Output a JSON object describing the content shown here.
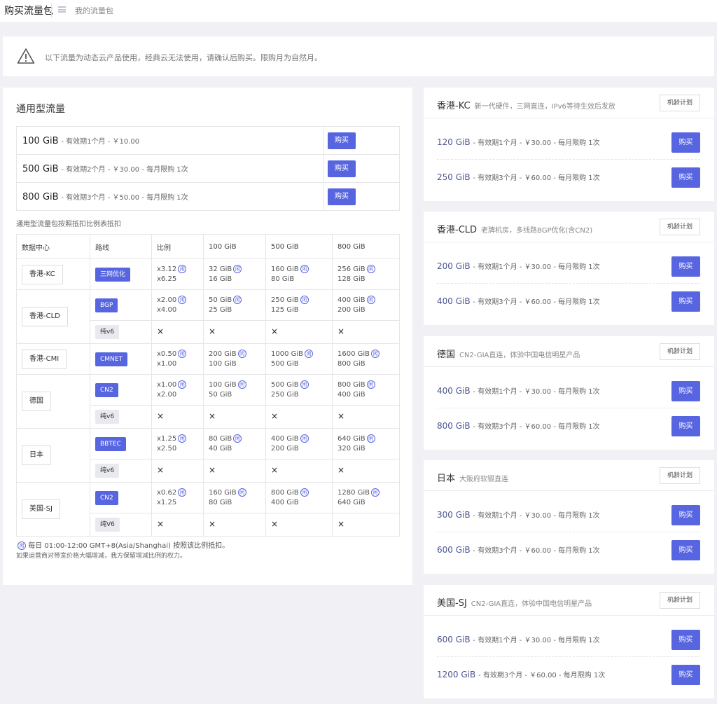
{
  "header": {
    "title": "购买流量包",
    "breadcrumb": "我的流量包"
  },
  "notice": {
    "text": "以下流量为动态云产品使用，经典云无法使用，请确认后购买。限购月为自然月。"
  },
  "general": {
    "title": "通用型流量",
    "buy_label": "购买",
    "packages": [
      {
        "size": "100 GiB",
        "meta": "- 有效期1个月 - ￥10.00"
      },
      {
        "size": "500 GiB",
        "meta": "- 有效期2个月 - ￥30.00 - 每月限购 1次"
      },
      {
        "size": "800 GiB",
        "meta": "- 有效期3个月 - ￥50.00 - 每月限购 1次"
      }
    ],
    "ratio_note": "通用型流量包按照抵扣比例表抵扣",
    "table_headers": [
      "数据中心",
      "路线",
      "比例",
      "100 GiB",
      "500 GiB",
      "800 GiB"
    ],
    "idle_mark": "闲",
    "x_mark": "×",
    "rows": [
      {
        "dc": "香港-KC",
        "route": "三网优化",
        "ratio": [
          "x3.12",
          "x6.25"
        ],
        "g100": [
          "32 GiB",
          "16 GiB"
        ],
        "g500": [
          "160 GiB",
          "80 GiB"
        ],
        "g800": [
          "256 GiB",
          "128 GiB"
        ]
      },
      {
        "dc": "香港-CLD",
        "route": "BGP",
        "ratio": [
          "x2.00",
          "x4.00"
        ],
        "g100": [
          "50 GiB",
          "25 GiB"
        ],
        "g500": [
          "250 GiB",
          "125 GiB"
        ],
        "g800": [
          "400 GiB",
          "200 GiB"
        ],
        "sub": "纯v6"
      },
      {
        "dc": "香港-CMI",
        "route": "CMNET",
        "ratio": [
          "x0.50",
          "x1.00"
        ],
        "g100": [
          "200 GiB",
          "100 GiB"
        ],
        "g500": [
          "1000 GiB",
          "500 GiB"
        ],
        "g800": [
          "1600 GiB",
          "800 GiB"
        ]
      },
      {
        "dc": "德国",
        "route": "CN2",
        "ratio": [
          "x1.00",
          "x2.00"
        ],
        "g100": [
          "100 GiB",
          "50 GiB"
        ],
        "g500": [
          "500 GiB",
          "250 GiB"
        ],
        "g800": [
          "800 GiB",
          "400 GiB"
        ],
        "sub": "纯v6"
      },
      {
        "dc": "日本",
        "route": "BBTEC",
        "ratio": [
          "x1.25",
          "x2.50"
        ],
        "g100": [
          "80 GiB",
          "40 GiB"
        ],
        "g500": [
          "400 GiB",
          "200 GiB"
        ],
        "g800": [
          "640 GiB",
          "320 GiB"
        ],
        "sub": "纯v6"
      },
      {
        "dc": "美国-SJ",
        "route": "CN2",
        "ratio": [
          "x0.62",
          "x1.25"
        ],
        "g100": [
          "160 GiB",
          "80 GiB"
        ],
        "g500": [
          "800 GiB",
          "400 GiB"
        ],
        "g800": [
          "1280 GiB",
          "640 GiB"
        ],
        "sub": "纯V6"
      }
    ],
    "footnote1": "每日 01:00-12:00 GMT+8(Asia/Shanghai) 按照该比例抵扣。",
    "footnote2": "如果运营商对带宽价格大幅增减，我方保留增减比例的权力。"
  },
  "regions": [
    {
      "name": "香港-KC",
      "desc": "新一代硬件，三网直连，IPv6等待生效后发放",
      "plan": "机龄计划",
      "items": [
        {
          "size": "120 GiB",
          "meta": "- 有效期1个月 - ￥30.00 - 每月限购 1次"
        },
        {
          "size": "250 GiB",
          "meta": "- 有效期3个月 - ￥60.00 - 每月限购 1次"
        }
      ]
    },
    {
      "name": "香港-CLD",
      "desc": "老牌机房，多线路BGP优化(含CN2)",
      "plan": "机龄计划",
      "items": [
        {
          "size": "200 GiB",
          "meta": "- 有效期1个月 - ￥30.00 - 每月限购 1次"
        },
        {
          "size": "400 GiB",
          "meta": "- 有效期3个月 - ￥60.00 - 每月限购 1次"
        }
      ]
    },
    {
      "name": "德国",
      "desc": "CN2-GIA直连，体验中国电信明星产品",
      "plan": "机龄计划",
      "items": [
        {
          "size": "400 GiB",
          "meta": "- 有效期1个月 - ￥30.00 - 每月限购 1次"
        },
        {
          "size": "800 GiB",
          "meta": "- 有效期3个月 - ￥60.00 - 每月限购 1次"
        }
      ]
    },
    {
      "name": "日本",
      "desc": "大阪府软银直连",
      "plan": "机龄计划",
      "items": [
        {
          "size": "300 GiB",
          "meta": "- 有效期1个月 - ￥30.00 - 每月限购 1次"
        },
        {
          "size": "600 GiB",
          "meta": "- 有效期3个月 - ￥60.00 - 每月限购 1次"
        }
      ]
    },
    {
      "name": "美国-SJ",
      "desc": "CN2-GIA直连，体验中国电信明星产品",
      "plan": "机龄计划",
      "items": [
        {
          "size": "600 GiB",
          "meta": "- 有效期1个月 - ￥30.00 - 每月限购 1次"
        },
        {
          "size": "1200 GiB",
          "meta": "- 有效期3个月 - ￥60.00 - 每月限购 1次"
        }
      ]
    }
  ]
}
